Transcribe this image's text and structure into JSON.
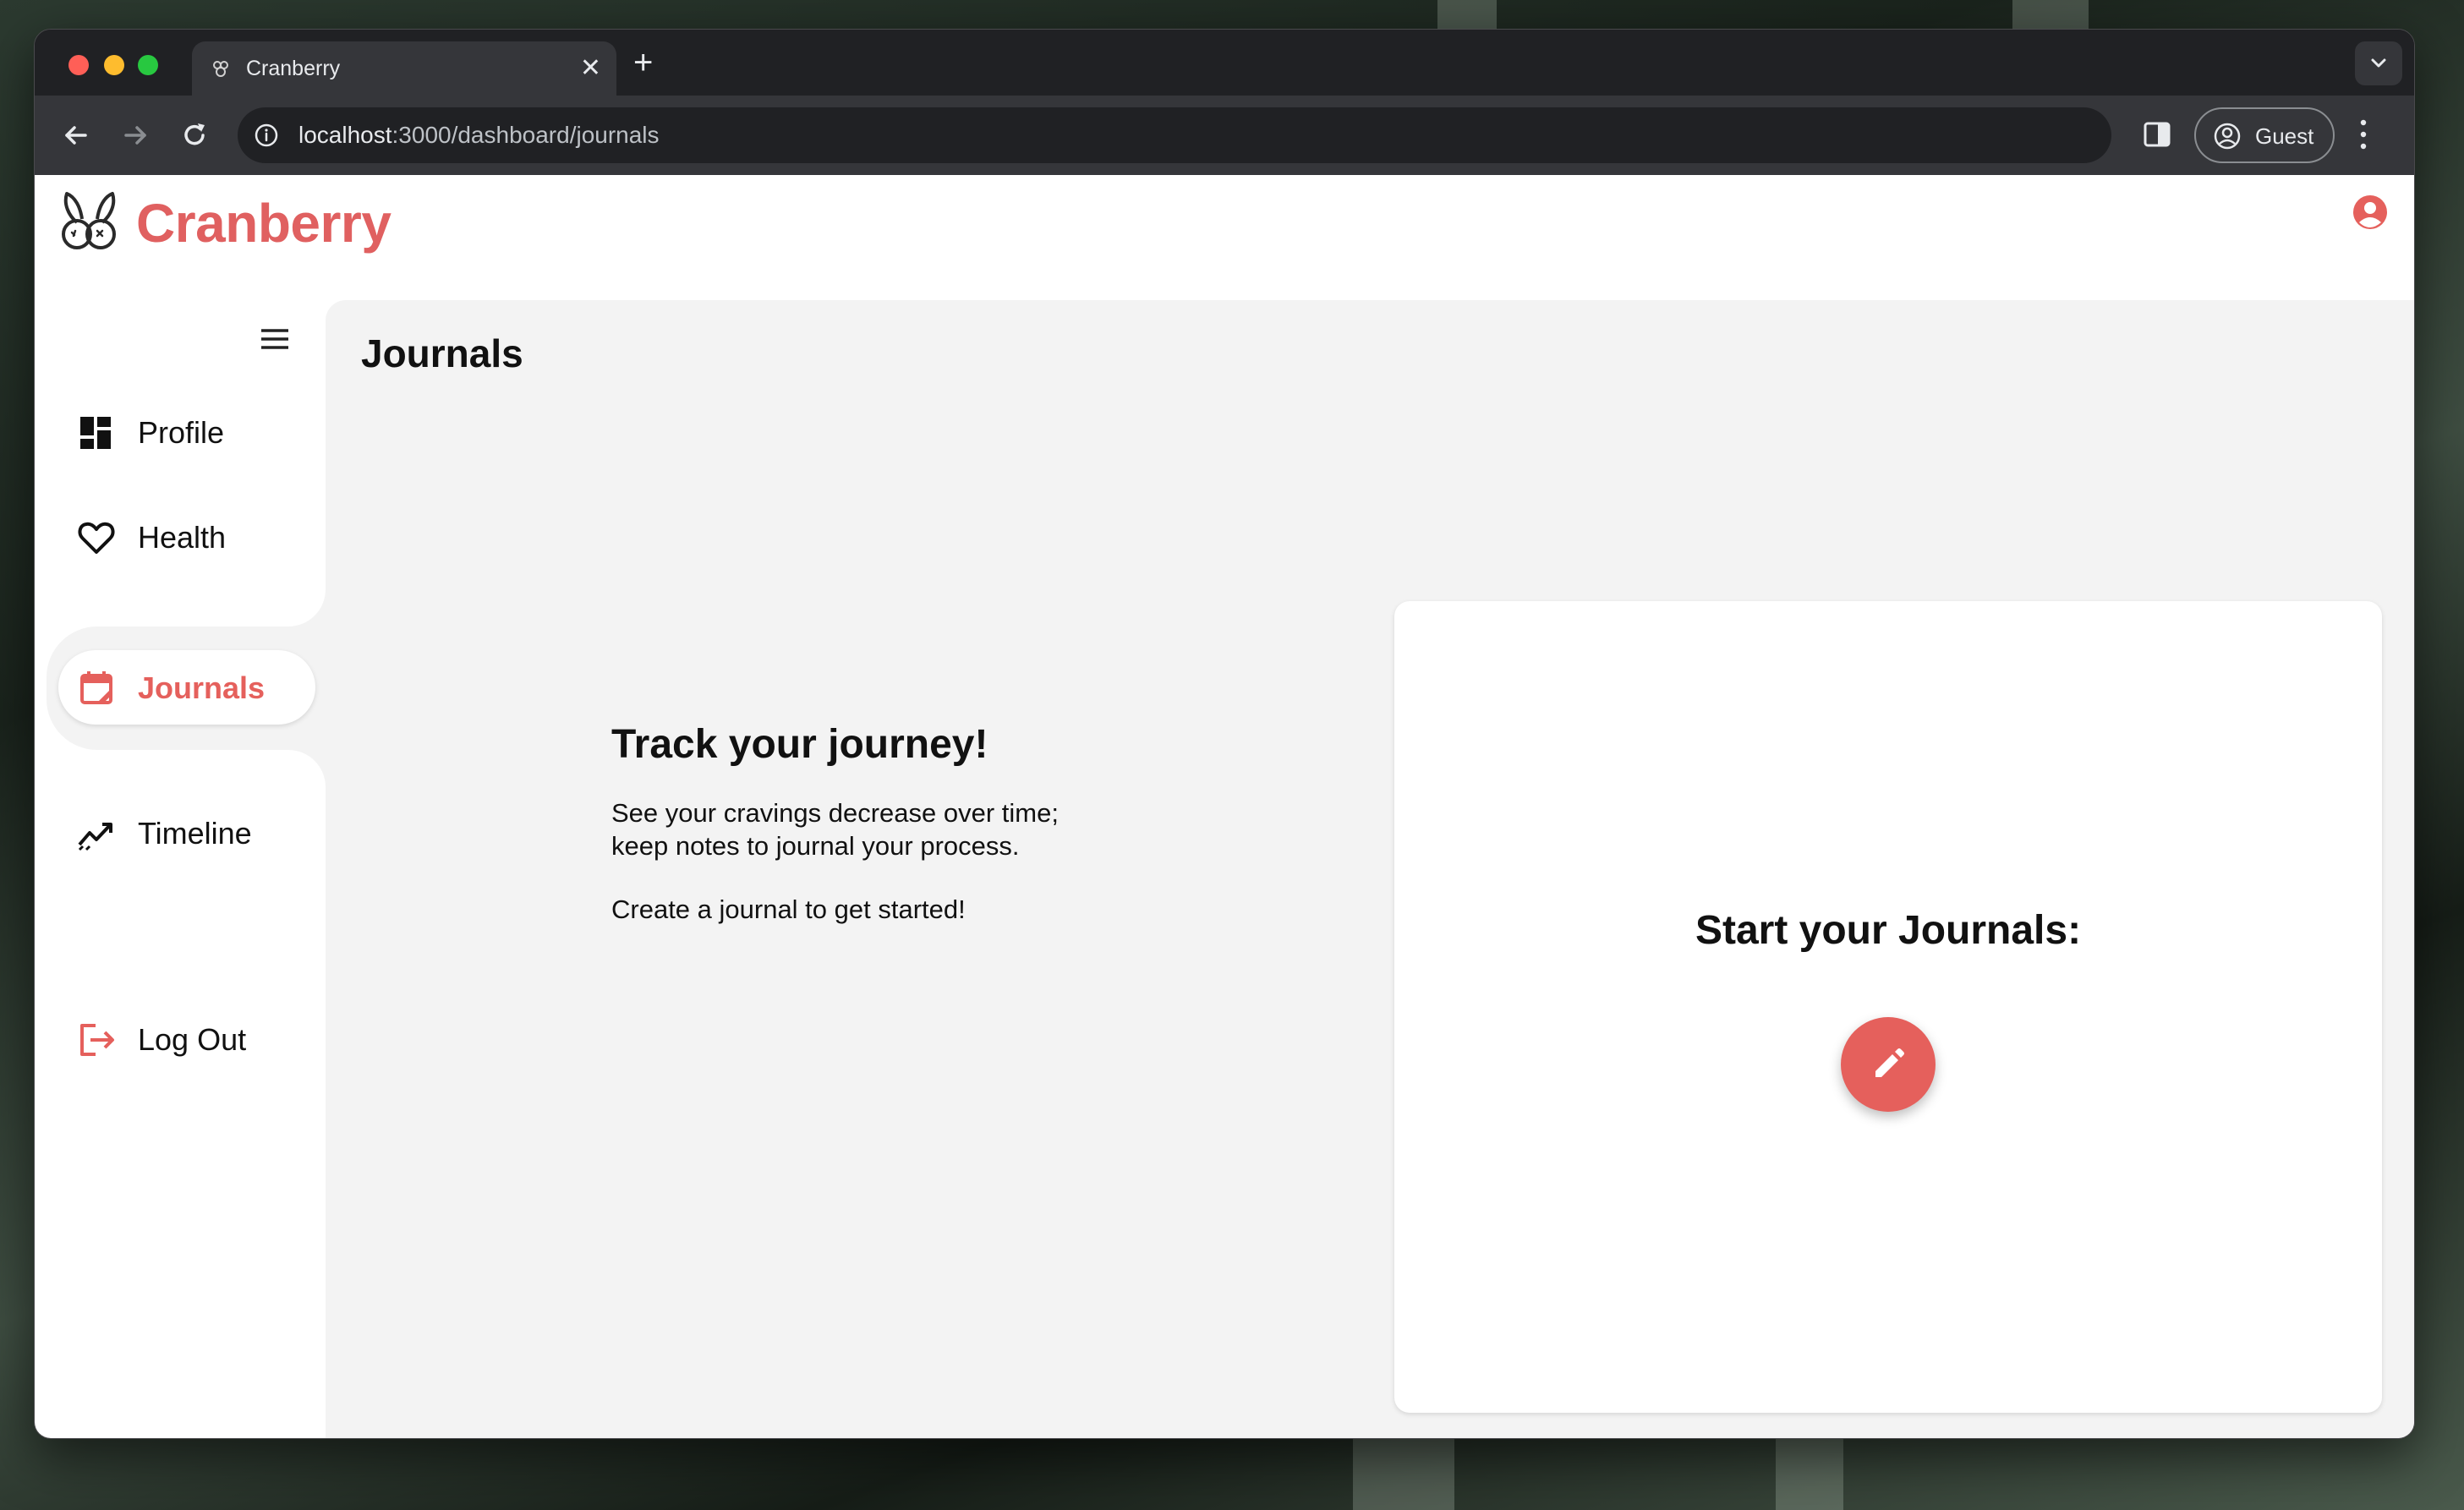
{
  "browser": {
    "tab_title": "Cranberry",
    "url_host": "localhost",
    "url_rest": ":3000/dashboard/journals",
    "profile_label": "Guest"
  },
  "app": {
    "brand": "Cranberry",
    "brand_color": "#e06060"
  },
  "sidebar": {
    "items": [
      {
        "label": "Profile",
        "icon": "dashboard-icon"
      },
      {
        "label": "Health",
        "icon": "heart-icon"
      },
      {
        "label": "Journals",
        "icon": "calendar-edit-icon",
        "active": true
      },
      {
        "label": "Timeline",
        "icon": "trending-up-icon"
      }
    ],
    "logout_label": "Log Out"
  },
  "main": {
    "title": "Journals",
    "intro_heading": "Track your journey!",
    "intro_line1": "See your cravings decrease over time;",
    "intro_line2": "keep notes to journal your process.",
    "intro_line3": "Create a journal to get started!",
    "card_heading": "Start your Journals:"
  }
}
